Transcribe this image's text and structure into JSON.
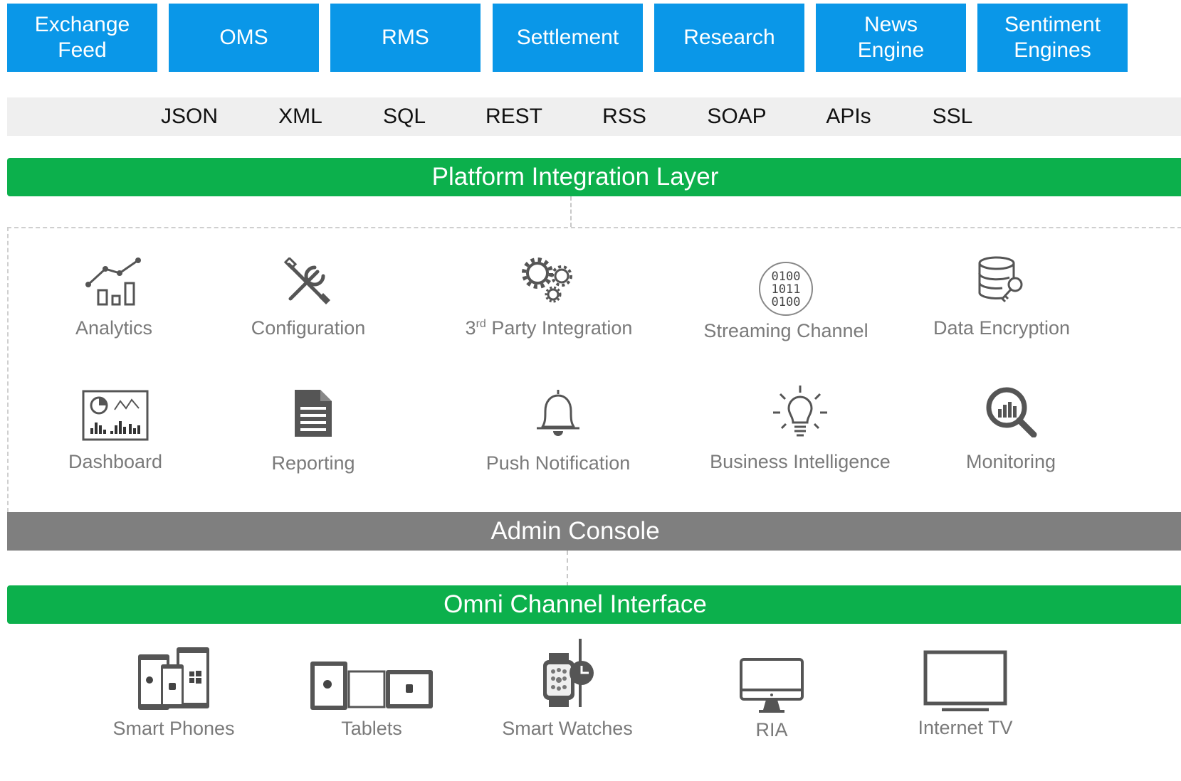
{
  "sources": [
    "Exchange\nFeed",
    "OMS",
    "RMS",
    "Settlement",
    "Research",
    "News\nEngine",
    "Sentiment\nEngines"
  ],
  "protocols": [
    "JSON",
    "XML",
    "SQL",
    "REST",
    "RSS",
    "SOAP",
    "APIs",
    "SSL"
  ],
  "layers": {
    "integration": "Platform Integration Layer",
    "admin": "Admin Console",
    "omni": "Omni Channel Interface"
  },
  "features": {
    "analytics": "Analytics",
    "configuration": "Configuration",
    "third_party_prefix": "3",
    "third_party_sup": "rd",
    "third_party_rest": " Party Integration",
    "streaming": "Streaming Channel",
    "streaming_bits": [
      "0100",
      "1011",
      "0100"
    ],
    "encryption": "Data Encryption",
    "dashboard": "Dashboard",
    "reporting": "Reporting",
    "push": "Push Notification",
    "bi": "Business Intelligence",
    "monitoring": "Monitoring"
  },
  "channels": {
    "phones": "Smart Phones",
    "tablets": "Tablets",
    "watches": "Smart Watches",
    "ria": "RIA",
    "tv": "Internet TV"
  },
  "colors": {
    "source_blue": "#0a97e8",
    "layer_green": "#0cb04c",
    "admin_grey": "#7f7f7f",
    "protocol_bar": "#efefef",
    "icon_grey": "#555555",
    "label_grey": "#7a7a7a"
  }
}
